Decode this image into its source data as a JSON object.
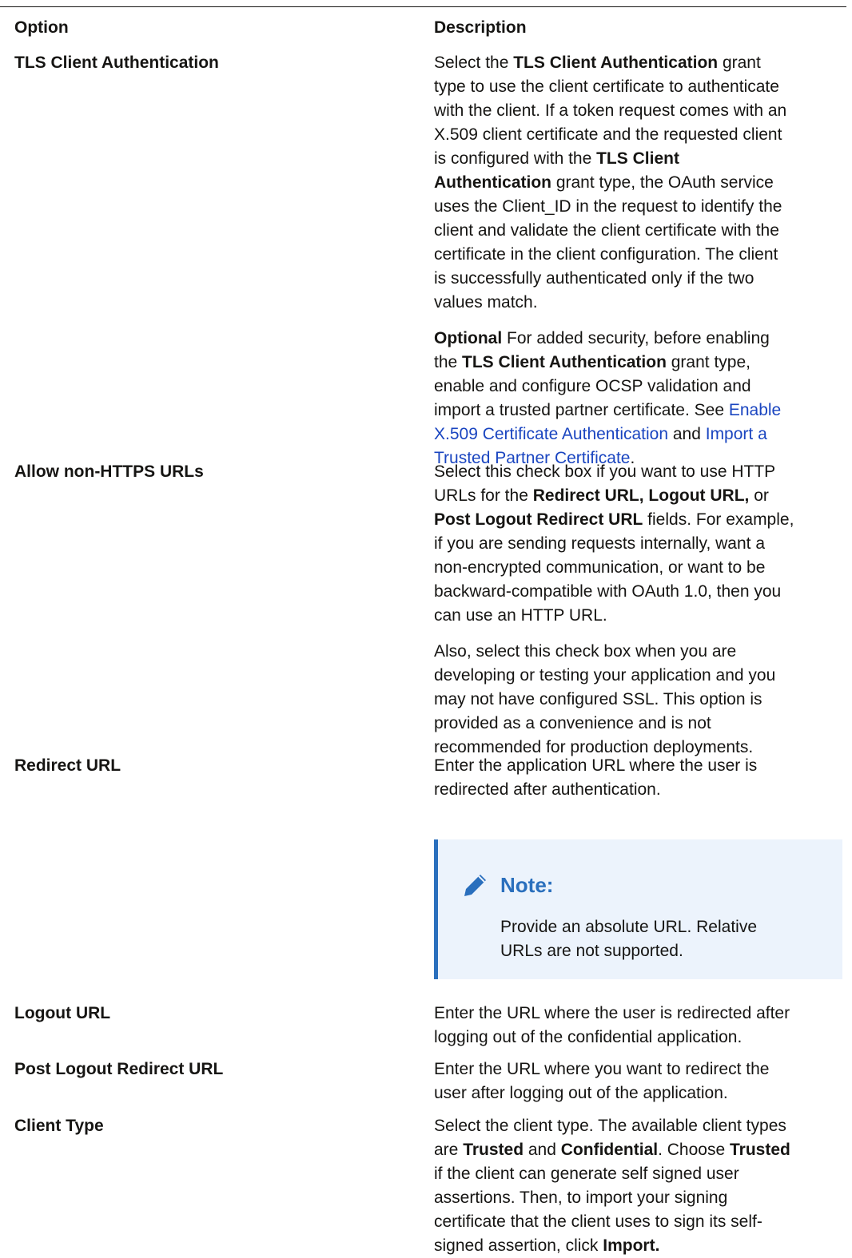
{
  "header": {
    "option": "Option",
    "description": "Description"
  },
  "rows": [
    {
      "option": "TLS Client Authentication",
      "lines": [
        [
          {
            "t": "Select the "
          },
          {
            "t": "TLS Client Authentication",
            "b": true
          },
          {
            "t": " grant"
          }
        ],
        [
          {
            "t": "type to use the client certificate to authenticate"
          }
        ],
        [
          {
            "t": "with the client. If a token request comes with an"
          }
        ],
        [
          {
            "t": "X.509 client certificate and the requested client"
          }
        ],
        [
          {
            "t": "is configured with the "
          },
          {
            "t": "TLS Client",
            "b": true
          }
        ],
        [
          {
            "t": "Authentication",
            "b": true
          },
          {
            "t": " grant type, the OAuth service"
          }
        ],
        [
          {
            "t": "uses the Client_ID in the request to identify the"
          }
        ],
        [
          {
            "t": "client and validate the client certificate with the"
          }
        ],
        [
          {
            "t": "certificate in the client configuration. The client"
          }
        ],
        [
          {
            "t": "is successfully authenticated only if the two"
          }
        ],
        [
          {
            "t": "values match."
          }
        ]
      ],
      "lines2": [
        [
          {
            "t": "Optional",
            "b": true
          },
          {
            "t": " For added security, before enabling"
          }
        ],
        [
          {
            "t": "the "
          },
          {
            "t": "TLS Client Authentication",
            "b": true
          },
          {
            "t": " grant type,"
          }
        ],
        [
          {
            "t": "enable and configure OCSP validation and"
          }
        ],
        [
          {
            "t": "import a trusted partner certificate. See "
          },
          {
            "t": "Enable",
            "link": true
          }
        ],
        [
          {
            "t": "X.509 Certificate Authentication",
            "link": true
          },
          {
            "t": " and "
          },
          {
            "t": "Import a",
            "link": true
          }
        ],
        [
          {
            "t": "Trusted Partner Certificate",
            "link": true
          },
          {
            "t": "."
          }
        ]
      ]
    },
    {
      "option": "Allow non-HTTPS URLs",
      "lines": [
        [
          {
            "t": "Select this check box if you want to use HTTP"
          }
        ],
        [
          {
            "t": "URLs for the "
          },
          {
            "t": "Redirect URL, Logout URL,",
            "b": true
          },
          {
            "t": " or"
          }
        ],
        [
          {
            "t": "Post Logout Redirect URL",
            "b": true
          },
          {
            "t": " fields. For example,"
          }
        ],
        [
          {
            "t": "if you are sending requests internally, want a"
          }
        ],
        [
          {
            "t": "non-encrypted communication, or want to be"
          }
        ],
        [
          {
            "t": "backward-compatible with OAuth 1.0, then you"
          }
        ],
        [
          {
            "t": "can use an HTTP URL."
          }
        ]
      ],
      "lines2": [
        [
          {
            "t": "Also, select this check box when you are"
          }
        ],
        [
          {
            "t": "developing or testing your application and you"
          }
        ],
        [
          {
            "t": "may not have configured SSL. This option is"
          }
        ],
        [
          {
            "t": "provided as a convenience and is not"
          }
        ],
        [
          {
            "t": "recommended for production deployments."
          }
        ]
      ]
    },
    {
      "option": "Redirect URL",
      "lines": [
        [
          {
            "t": "Enter the application URL where the user is"
          }
        ],
        [
          {
            "t": "redirected after authentication."
          }
        ]
      ],
      "note": {
        "icon": "pencil-icon",
        "title": "Note:",
        "lines": [
          [
            {
              "t": "Provide an absolute URL. Relative"
            }
          ],
          [
            {
              "t": "URLs are not supported."
            }
          ]
        ]
      }
    },
    {
      "option": "Logout URL",
      "lines": [
        [
          {
            "t": "Enter the URL where the user is redirected after"
          }
        ],
        [
          {
            "t": "logging out of the confidential application."
          }
        ]
      ]
    },
    {
      "option": "Post Logout Redirect URL",
      "lines": [
        [
          {
            "t": "Enter the URL where you want to redirect the"
          }
        ],
        [
          {
            "t": "user after logging out of the application."
          }
        ]
      ]
    },
    {
      "option": "Client Type",
      "lines": [
        [
          {
            "t": "Select the client type. The available client types"
          }
        ],
        [
          {
            "t": "are "
          },
          {
            "t": "Trusted",
            "b": true
          },
          {
            "t": " and "
          },
          {
            "t": "Confidential",
            "b": true
          },
          {
            "t": ". Choose "
          },
          {
            "t": "Trusted",
            "b": true
          }
        ],
        [
          {
            "t": "if the client can generate self signed user"
          }
        ],
        [
          {
            "t": "assertions. Then, to import your signing"
          }
        ],
        [
          {
            "t": "certificate that the client uses to sign its self-"
          }
        ],
        [
          {
            "t": "signed assertion, click "
          },
          {
            "t": "Import.",
            "b": true
          }
        ]
      ]
    }
  ]
}
